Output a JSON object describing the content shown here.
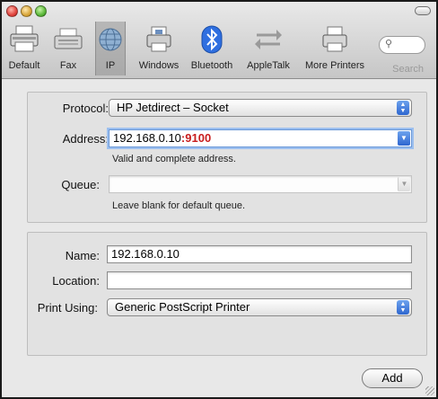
{
  "toolbar": {
    "items": [
      {
        "label": "Default",
        "icon": "default-printer-icon"
      },
      {
        "label": "Fax",
        "icon": "fax-icon"
      },
      {
        "label": "IP",
        "icon": "globe-icon",
        "selected": true
      },
      {
        "label": "Windows",
        "icon": "windows-printer-icon"
      },
      {
        "label": "Bluetooth",
        "icon": "bluetooth-icon"
      },
      {
        "label": "AppleTalk",
        "icon": "appletalk-icon"
      },
      {
        "label": "More Printers",
        "icon": "printer-icon"
      }
    ],
    "search_label": "Search"
  },
  "form": {
    "protocol_label": "Protocol:",
    "protocol_value": "HP Jetdirect – Socket",
    "address_label": "Address:",
    "address_host": "192.168.0.10",
    "address_sep": ":",
    "address_port": "9100",
    "address_hint": "Valid and complete address.",
    "queue_label": "Queue:",
    "queue_value": "",
    "queue_hint": "Leave blank for default queue."
  },
  "details": {
    "name_label": "Name:",
    "name_value": "192.168.0.10",
    "location_label": "Location:",
    "location_value": "",
    "print_using_label": "Print Using:",
    "print_using_value": "Generic PostScript Printer"
  },
  "actions": {
    "add_label": "Add"
  },
  "colors": {
    "port_text": "#c81e1e",
    "stepper_blue": "#2e66cf"
  }
}
